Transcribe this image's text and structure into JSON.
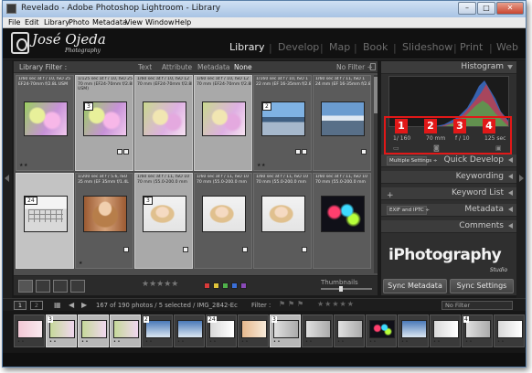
{
  "window": {
    "title": "Revelado - Adobe Photoshop Lightroom - Library",
    "buttons": {
      "minimize": "–",
      "maximize": "□",
      "close": "✕"
    }
  },
  "menu": [
    "File",
    "Edit",
    "Library",
    "Photo",
    "Metadata",
    "View",
    "Window",
    "Help"
  ],
  "identity": {
    "name": "José Ojeda",
    "subtitle": "Photography",
    "modules": [
      "Library",
      "Develop",
      "Map",
      "Book",
      "Slideshow",
      "Print",
      "Web"
    ],
    "separator": "|",
    "active_module": "Library"
  },
  "filter_bar": {
    "label": "Library Filter :",
    "tabs": [
      "Text",
      "Attribute",
      "Metadata",
      "None"
    ],
    "active_tab": "None",
    "preset": "No Filter ÷"
  },
  "grid": {
    "rows": [
      [
        {
          "meta": "1/60 sec at f / 10, ISO 25\nEF24-70mm f/2.8L USM",
          "index": "",
          "photo": "ph-flowers",
          "state": "normal",
          "stars": "★★",
          "badges": 0
        },
        {
          "meta": "1/125 sec at f / 10, ISO 25\n70 mm (EF24-70mm f/2.8L\nUSM)",
          "index": "3",
          "photo": "ph-flowers",
          "state": "selected",
          "stars": "",
          "badges": 2
        },
        {
          "meta": "1/60 sec at f / 10, ISO 12\n70 mm (EF24-70mm f/2.8L",
          "index": "",
          "photo": "ph-flowers2",
          "state": "selected",
          "stars": "",
          "badges": 0
        },
        {
          "meta": "1/60 sec at f / 10, ISO 12\n70 mm (EF24-70mm f/2.8L",
          "index": "",
          "photo": "ph-flowers2",
          "state": "selected",
          "stars": "",
          "badges": 0
        },
        {
          "meta": "1/160 sec at f / 10, ISO 1\n22 mm (EF 16-35mm f/2.8",
          "index": "2",
          "photo": "ph-city",
          "state": "normal",
          "stars": "★★",
          "badges": 2
        },
        {
          "meta": "1/60 sec at f / 11, ISO 1\n24 mm (EF 16-35mm f/2.8",
          "index": "",
          "photo": "ph-city2",
          "state": "normal",
          "stars": "",
          "badges": 1
        }
      ],
      [
        {
          "meta": "",
          "index": "24",
          "photo": "ph-cal",
          "state": "light",
          "stars": "",
          "badges": 0
        },
        {
          "meta": "1/200 sec at f / 5.6, ISO\n35 mm (EF 35mm f/1.4L",
          "index": "",
          "photo": "ph-woman",
          "state": "normal",
          "stars": "★",
          "badges": 1
        },
        {
          "meta": "1/60 sec at f / 11, ISO 10\n70 mm (55.0-200.0 mm",
          "index": "3",
          "photo": "ph-portrait",
          "state": "selected",
          "stars": "",
          "badges": 1
        },
        {
          "meta": "1/60 sec at f / 11, ISO 10\n70 mm (55.0-200.0 mm",
          "index": "",
          "photo": "ph-portrait",
          "state": "normal",
          "stars": "",
          "badges": 1
        },
        {
          "meta": "1/60 sec at f / 11, ISO 10\n70 mm (55.0-200.0 mm",
          "index": "",
          "photo": "ph-portrait",
          "state": "normal",
          "stars": "",
          "badges": 1
        },
        {
          "meta": "1/60 sec at f / 11, ISO 10\n70 mm (55.0-200.0 mm",
          "index": "",
          "photo": "ph-colorful",
          "state": "normal",
          "stars": "",
          "badges": 0
        }
      ]
    ]
  },
  "toolbar": {
    "rating": "★★★★★",
    "flag_colors": [
      "#d83a3a",
      "#e0c43a",
      "#4fb04a",
      "#3a6fd8",
      "#8a4ab8"
    ],
    "thumbnails_label": "Thumbnails"
  },
  "right_panel": {
    "histogram": "Histogram",
    "histogram_values": [
      "1/ 160",
      "70 mm",
      "f / 10",
      "125 sec"
    ],
    "callout_numbers": [
      "1",
      "2",
      "3",
      "4"
    ],
    "quick_develop": "Quick Develop",
    "quick_develop_preset": "Multiple Settings ÷",
    "keywording": "Keywording",
    "keyword_list": "Keyword List",
    "keyword_add": "+",
    "metadata": "Metadata",
    "metadata_preset": "EXIF and IPTC ÷",
    "comments": "Comments",
    "brand": "iPhotography",
    "brand_sub": "Studio",
    "sync_metadata": "Sync Metadata",
    "sync_settings": "Sync Settings"
  },
  "filmstrip_bar": {
    "pages": [
      "1",
      "2"
    ],
    "info": "167 of 190 photos / 5 selected / IMG_2842-Ec",
    "filter_label": "Filter :",
    "no_filter": "No Filter"
  },
  "filmstrip": [
    {
      "img": "ph-fs1",
      "num": "",
      "selected": false
    },
    {
      "img": "ph-fs2",
      "num": "3",
      "selected": true
    },
    {
      "img": "ph-fs2",
      "num": "",
      "selected": true
    },
    {
      "img": "ph-fs2",
      "num": "",
      "selected": true
    },
    {
      "img": "ph-fs3",
      "num": "2",
      "selected": false
    },
    {
      "img": "ph-fs3",
      "num": "",
      "selected": false
    },
    {
      "img": "ph-fs4",
      "num": "24",
      "selected": false
    },
    {
      "img": "ph-fs5",
      "num": "",
      "selected": false
    },
    {
      "img": "ph-fs6",
      "num": "3",
      "selected": true
    },
    {
      "img": "ph-fs6",
      "num": "",
      "selected": false
    },
    {
      "img": "ph-fs6",
      "num": "",
      "selected": false
    },
    {
      "img": "ph-colorful",
      "num": "",
      "selected": false
    },
    {
      "img": "ph-fs3",
      "num": "",
      "selected": false
    },
    {
      "img": "ph-fs4",
      "num": "",
      "selected": false
    },
    {
      "img": "ph-fs6",
      "num": "4",
      "selected": false
    },
    {
      "img": "ph-fs4",
      "num": "",
      "selected": false
    }
  ]
}
